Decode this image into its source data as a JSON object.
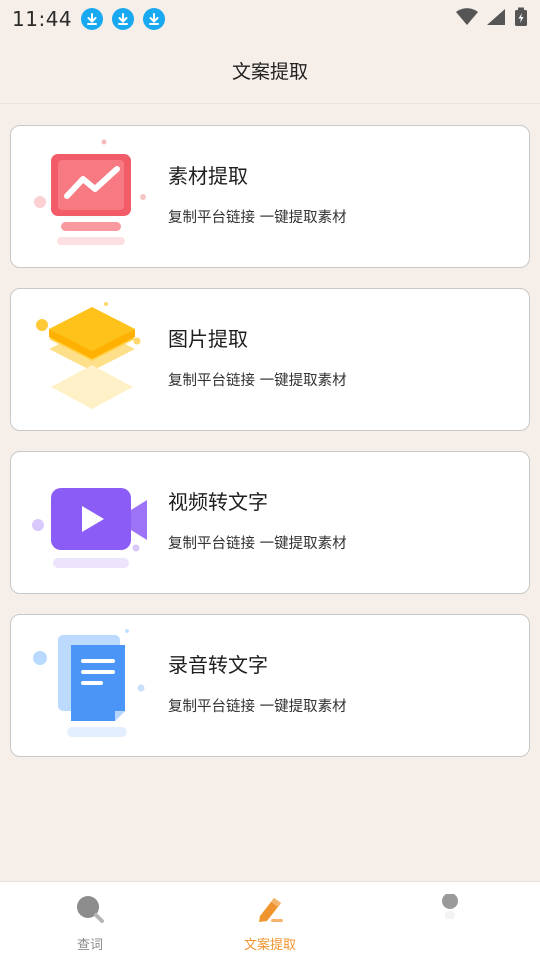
{
  "status_bar": {
    "time": "11:44",
    "download_icons": [
      "download-icon",
      "download-icon",
      "download-icon"
    ],
    "right_icons": [
      "wifi-icon",
      "signal-icon",
      "battery-icon"
    ]
  },
  "header": {
    "title": "文案提取"
  },
  "cards": [
    {
      "title": "素材提取",
      "subtitle": "复制平台链接 一键提取素材",
      "icon": "chart-screen-icon",
      "color": "#f25c68"
    },
    {
      "title": "图片提取",
      "subtitle": "复制平台链接 一键提取素材",
      "icon": "layers-icon",
      "color": "#ffc21a"
    },
    {
      "title": "视频转文字",
      "subtitle": "复制平台链接 一键提取素材",
      "icon": "video-camera-icon",
      "color": "#8b5cf6"
    },
    {
      "title": "录音转文字",
      "subtitle": "复制平台链接 一键提取素材",
      "icon": "document-icon",
      "color": "#4a95f5"
    }
  ],
  "bottom_nav": {
    "items": [
      {
        "label": "查词",
        "icon": "search-icon",
        "active": false
      },
      {
        "label": "文案提取",
        "icon": "pen-icon",
        "active": true
      },
      {
        "label": "",
        "icon": "profile-icon",
        "active": false
      }
    ]
  },
  "colors": {
    "background": "#f6efe9",
    "accent": "#f0952e",
    "status_icon": "#19a9f0"
  }
}
